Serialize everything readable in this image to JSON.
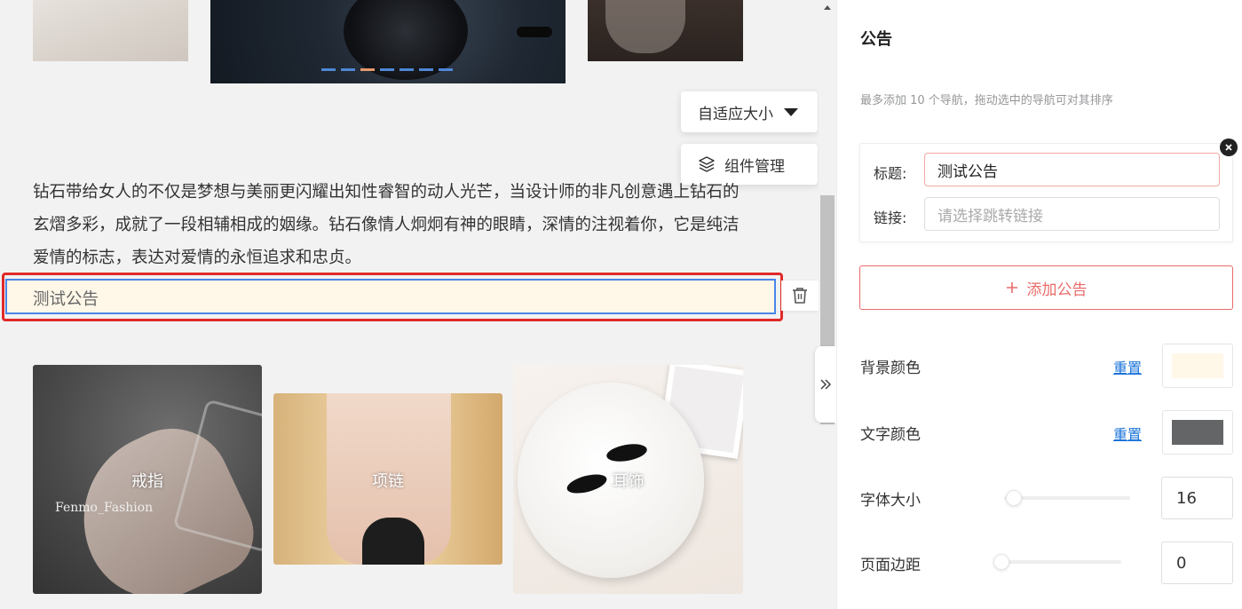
{
  "canvas": {
    "size_dropdown_label": "自适应大小",
    "component_mgr_label": "组件管理",
    "rich_text": "钻石带给女人的不仅是梦想与美丽更闪耀出知性睿智的动人光芒，当设计师的非凡创意遇上钻石的玄熠多彩，成就了一段相辅相成的姻缘。钻石像情人炯炯有神的眼睛，深情的注视着你，它是纯洁爱情的标志，表达对爱情的永恒追求和忠贞。",
    "notice_text": "测试公告",
    "categories": [
      {
        "label": "戒指",
        "brand": "Fenmo_Fashion"
      },
      {
        "label": "项链"
      },
      {
        "label": "耳饰"
      }
    ]
  },
  "panel": {
    "title": "公告",
    "hint": "最多添加 10 个导航，拖动选中的导航可对其排序",
    "title_label": "标题:",
    "title_value": "测试公告",
    "link_label": "链接:",
    "link_placeholder": "请选择跳转链接",
    "add_button": "添加公告",
    "bg_color_label": "背景颜色",
    "bg_reset": "重置",
    "bg_color": "#fff7e8",
    "text_color_label": "文字颜色",
    "text_reset": "重置",
    "text_color": "#646566",
    "font_size_label": "字体大小",
    "font_size_value": "16",
    "page_margin_label": "页面边距",
    "page_margin_value": "0"
  }
}
